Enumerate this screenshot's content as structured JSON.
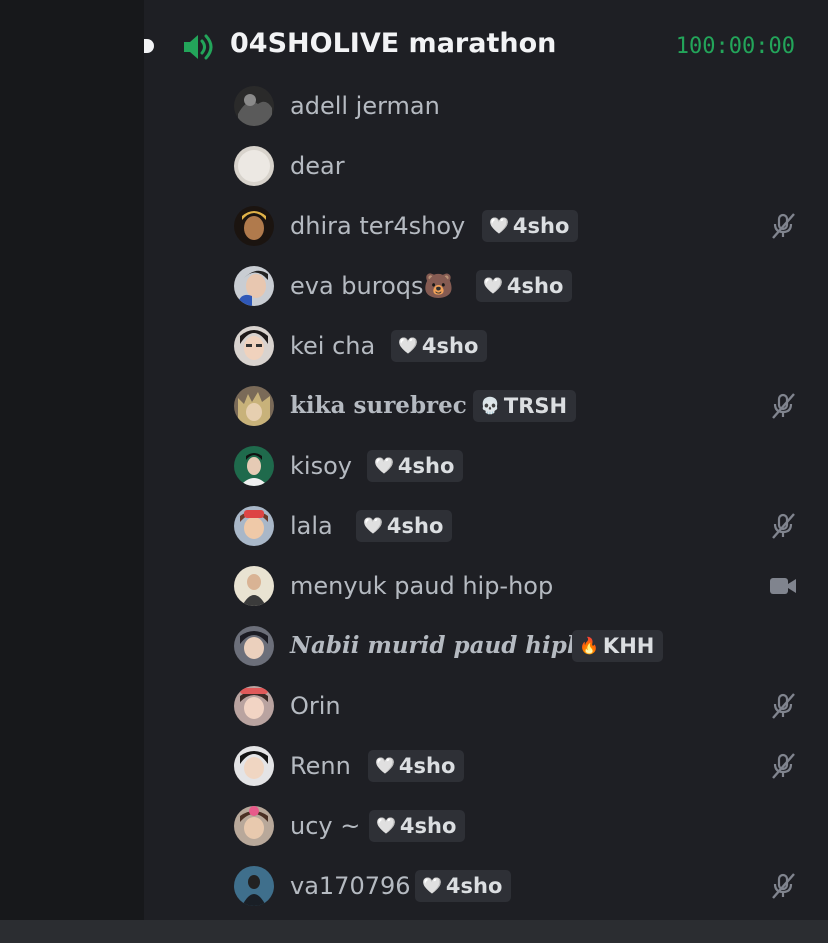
{
  "channel": {
    "name": "04SHOLIVE marathon",
    "timer": "100:00:00",
    "icon": "speaker-icon",
    "accent_color": "#23a55a"
  },
  "members": [
    {
      "name": "adell jerman",
      "tag": null,
      "status": null
    },
    {
      "name": "dear",
      "tag": null,
      "status": null
    },
    {
      "name": "dhira ter4shoy",
      "tag": {
        "icon": "white-heart-icon",
        "text": "4sho"
      },
      "status": "muted"
    },
    {
      "name": "eva buroqs🐻",
      "tag": {
        "icon": "white-heart-icon",
        "text": "4sho"
      },
      "status": null
    },
    {
      "name": "kei cha",
      "tag": {
        "icon": "white-heart-icon",
        "text": "4sho"
      },
      "status": null
    },
    {
      "name": "𝐤𝐢𝐤𝐚 𝐬𝐮𝐫𝐞𝐛𝐫𝐞𝐜",
      "tag": {
        "icon": "skull-icon",
        "text": "TRSH"
      },
      "status": "muted"
    },
    {
      "name": "kisoy",
      "tag": {
        "icon": "white-heart-icon",
        "text": "4sho"
      },
      "status": null
    },
    {
      "name": "lala",
      "tag": {
        "icon": "white-heart-icon",
        "text": "4sho"
      },
      "status": "muted"
    },
    {
      "name": "menyuk paud hip-hop",
      "tag": null,
      "status": "video"
    },
    {
      "name": "Nabii murid paud hiphop",
      "tag": {
        "icon": "fire-icon",
        "text": "KHH"
      },
      "status": null
    },
    {
      "name": "Orin",
      "tag": null,
      "status": "muted"
    },
    {
      "name": "Renn",
      "tag": {
        "icon": "white-heart-icon",
        "text": "4sho"
      },
      "status": "muted"
    },
    {
      "name": "ucy ~",
      "tag": {
        "icon": "white-heart-icon",
        "text": "4sho"
      },
      "status": null
    },
    {
      "name": "va170796",
      "tag": {
        "icon": "white-heart-icon",
        "text": "4sho"
      },
      "status": "muted"
    }
  ]
}
